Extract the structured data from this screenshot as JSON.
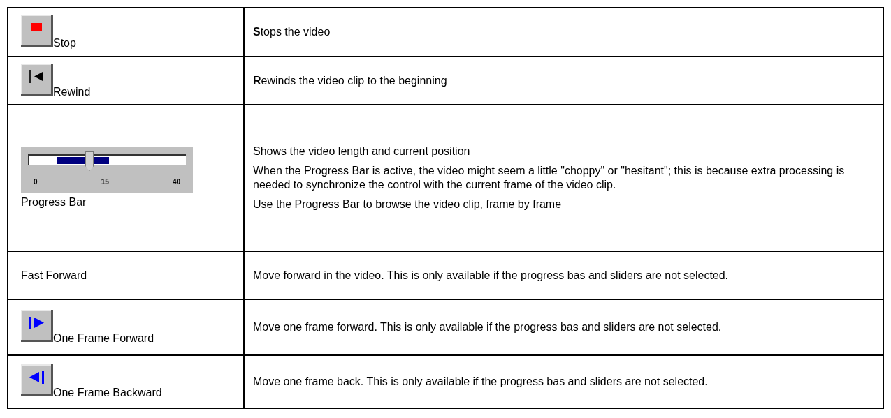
{
  "rows": [
    {
      "kind": "stop",
      "label": "Stop",
      "description": [
        "**S**tops the video"
      ]
    },
    {
      "kind": "rewind",
      "label": "Rewind",
      "description": [
        "**R**ewinds the video clip to the beginning"
      ]
    },
    {
      "kind": "slider",
      "label": "Progress Bar",
      "slider": {
        "level": 0.38,
        "ticks": [
          "0",
          "15",
          "40"
        ]
      },
      "description": [
        "Shows the video length and current position",
        "When the Progress Bar is active, the video might seem a little \"choppy\" or \"hesitant\"; this is because extra processing is needed to synchronize the control with the current frame of the video clip.",
        "Use the Progress Bar to browse the video clip, frame by frame"
      ]
    },
    {
      "kind": "text",
      "label": "Fast Forward",
      "description": [
        "Move forward in the video. This is only available if the progress bas and sliders are not selected."
      ]
    },
    {
      "kind": "step-forward",
      "label": "One Frame Forward",
      "description": [
        "Move one frame forward. This is only available if the progress bas and sliders are not selected."
      ]
    },
    {
      "kind": "step-back",
      "label": "One Frame Backward",
      "description": [
        "Move one frame back. This is only available if the progress bas and sliders are not selected."
      ]
    }
  ]
}
